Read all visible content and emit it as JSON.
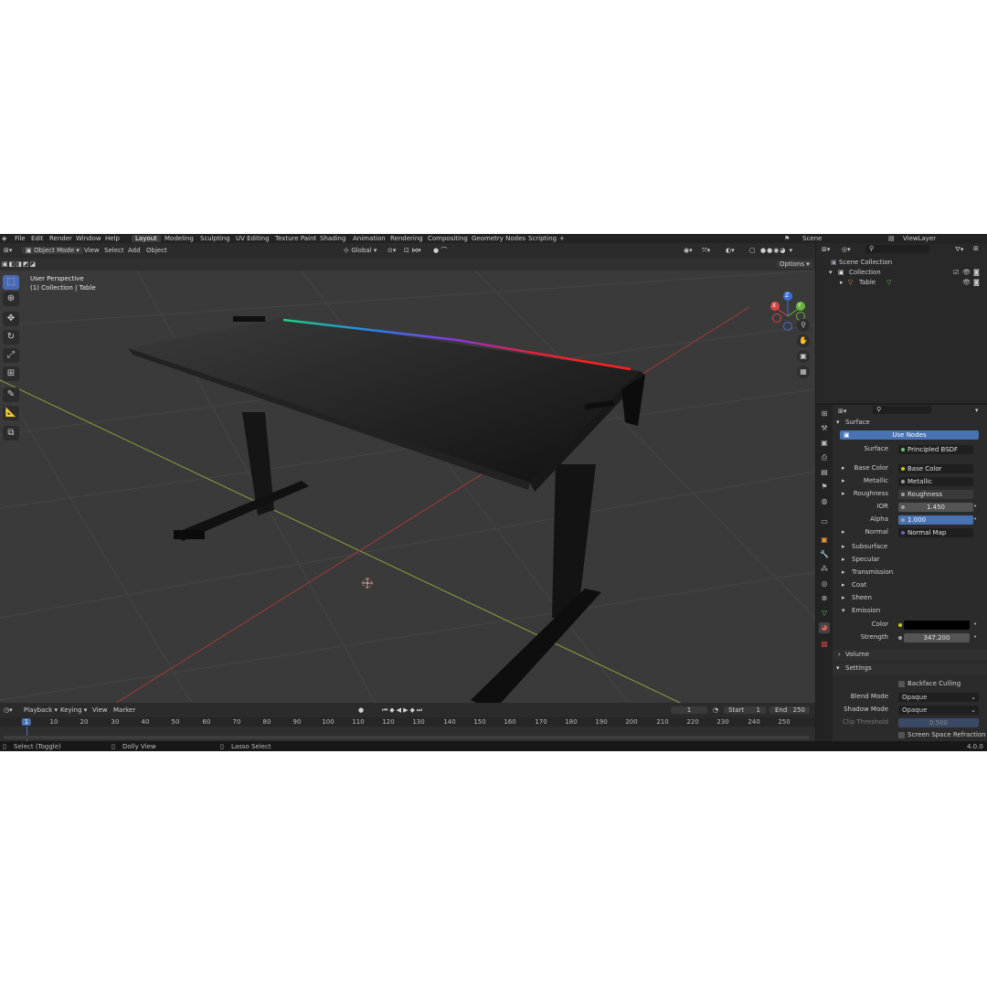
{
  "menu": {
    "items": [
      "File",
      "Edit",
      "Render",
      "Window",
      "Help"
    ],
    "workspaces": [
      "Layout",
      "Modeling",
      "Sculpting",
      "UV Editing",
      "Texture Paint",
      "Shading",
      "Animation",
      "Rendering",
      "Compositing",
      "Geometry Nodes",
      "Scripting"
    ],
    "active_workspace": "Layout",
    "add_tab": "+",
    "scene": "Scene",
    "view_layer": "ViewLayer"
  },
  "viewport_header": {
    "mode": "Object Mode",
    "menus": [
      "View",
      "Select",
      "Add",
      "Object"
    ],
    "orientation": "Global",
    "options": "Options"
  },
  "viewport": {
    "perspective": "User Perspective",
    "collection_info": "(1) Collection | Table",
    "axis_labels": [
      "Z",
      "Y",
      "X"
    ]
  },
  "timeline": {
    "menus": [
      "Playback",
      "Keying",
      "View",
      "Marker"
    ],
    "current_frame": "1",
    "start_label": "Start",
    "start": "1",
    "end_label": "End",
    "end": "250",
    "ruler": [
      "1",
      "10",
      "20",
      "30",
      "40",
      "50",
      "60",
      "70",
      "80",
      "90",
      "100",
      "110",
      "120",
      "130",
      "140",
      "150",
      "160",
      "170",
      "180",
      "190",
      "200",
      "210",
      "220",
      "230",
      "240",
      "250"
    ]
  },
  "statusbar": {
    "select": "Select (Toggle)",
    "dolly": "Dolly View",
    "lasso": "Lasso Select",
    "version": "4.0.0"
  },
  "outliner": {
    "scene_collection": "Scene Collection",
    "collection": "Collection",
    "object": "Table"
  },
  "properties": {
    "surface_section": "Surface",
    "use_nodes": "Use Nodes",
    "rows": [
      {
        "label": "Surface",
        "value": "Principled BSDF",
        "kind": "link",
        "dot": "#6bc86b"
      },
      {
        "label": "Base Color",
        "value": "Base Color",
        "kind": "link",
        "dot": "#c7c729",
        "expand": "▸"
      },
      {
        "label": "Metallic",
        "value": "Metallic",
        "kind": "link",
        "dot": "#a1a1a1",
        "expand": "▸"
      },
      {
        "label": "Roughness",
        "value": "Roughness",
        "kind": "link-sel",
        "dot": "#a1a1a1",
        "expand": "▸"
      },
      {
        "label": "IOR",
        "value": "1.450",
        "kind": "num",
        "dot": "#a1a1a1"
      },
      {
        "label": "Alpha",
        "value": "1.000",
        "kind": "blue",
        "dot": "#a1a1a1"
      },
      {
        "label": "Normal",
        "value": "Normal Map",
        "kind": "link",
        "dot": "#6363c7",
        "expand": "▸"
      }
    ],
    "subsections": [
      "Subsurface",
      "Specular",
      "Transmission",
      "Coat",
      "Sheen",
      "Emission"
    ],
    "emission_color_label": "Color",
    "emission_strength_label": "Strength",
    "emission_strength": "347.200",
    "volume_section": "Volume",
    "settings_section": "Settings",
    "backface_culling": "Backface Culling",
    "blend_mode_label": "Blend Mode",
    "blend_mode": "Opaque",
    "shadow_mode_label": "Shadow Mode",
    "shadow_mode": "Opaque",
    "clip_threshold_label": "Clip Threshold",
    "clip_threshold": "0.500",
    "screen_space_refraction": "Screen Space Refraction"
  }
}
